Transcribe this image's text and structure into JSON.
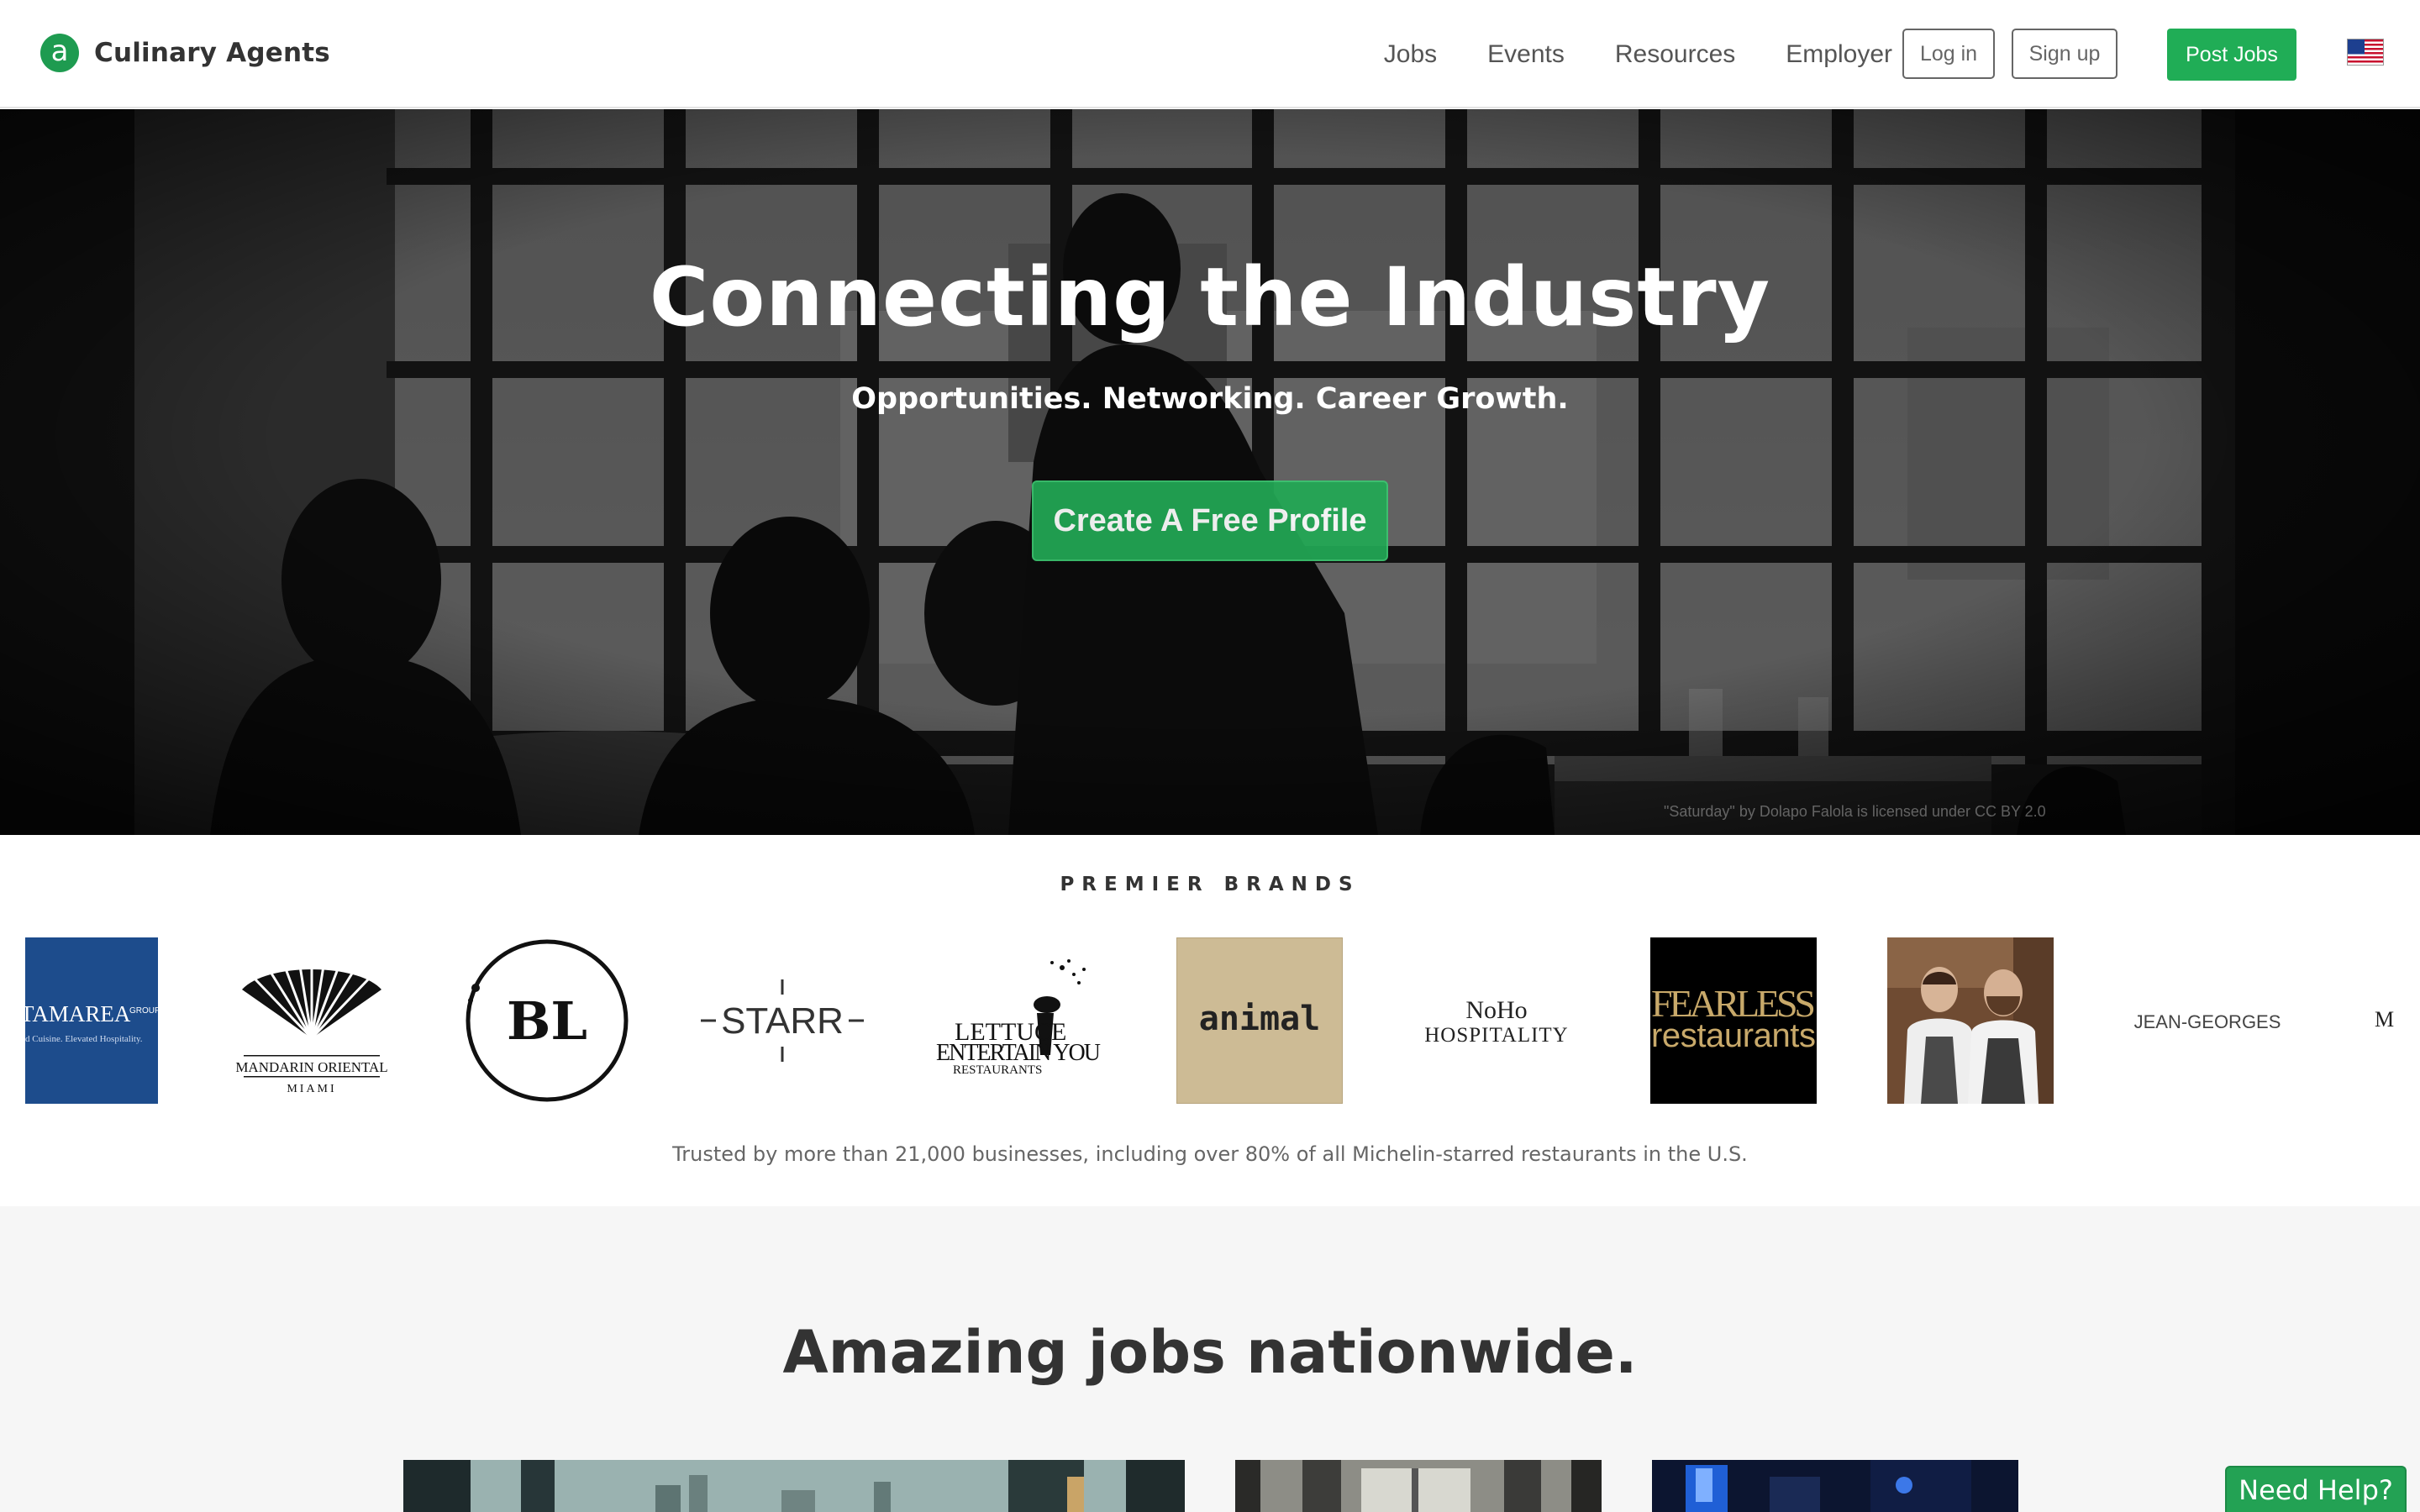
{
  "brand": {
    "name": "Culinary Agents",
    "mark": "a",
    "accent": "#20ad56"
  },
  "nav": {
    "links": [
      "Jobs",
      "Events",
      "Resources",
      "Employer"
    ],
    "login": "Log in",
    "signup": "Sign up",
    "post_jobs": "Post Jobs",
    "region_icon": "us-flag-icon"
  },
  "hero": {
    "title": "Connecting the Industry",
    "subtitle": "Opportunities. Networking. Career Growth.",
    "cta": "Create A Free Profile",
    "photo_credit": "\"Saturday\" by Dolapo Falola is licensed under CC BY 2.0"
  },
  "brands": {
    "heading": "PREMIER BRANDS",
    "logos": [
      {
        "main": "TAMAREA",
        "tag": "GROUP",
        "sub": "d Cuisine. Elevated Hospitality."
      },
      {
        "main": "MANDARIN ORIENTAL",
        "sub": "MIAMI"
      },
      {
        "main": "BL"
      },
      {
        "main": "STARR"
      },
      {
        "main": "LETTUCE",
        "line2": "ENTERTAIN YOU",
        "sub": "RESTAURANTS"
      },
      {
        "main": "animal"
      },
      {
        "main": "NoHo",
        "sub": "HOSPITALITY"
      },
      {
        "main": "FEARLESS",
        "sub": "restaurants"
      },
      {
        "main": "chefs-photo"
      },
      {
        "main": "JEAN-GEORGES"
      },
      {
        "main": "M"
      }
    ],
    "trusted": "Trusted by more than 21,000 businesses, including over 80% of all Michelin-starred restaurants in the U.S."
  },
  "jobs": {
    "heading": "Amazing jobs nationwide."
  },
  "help": {
    "label": "Need Help?"
  }
}
